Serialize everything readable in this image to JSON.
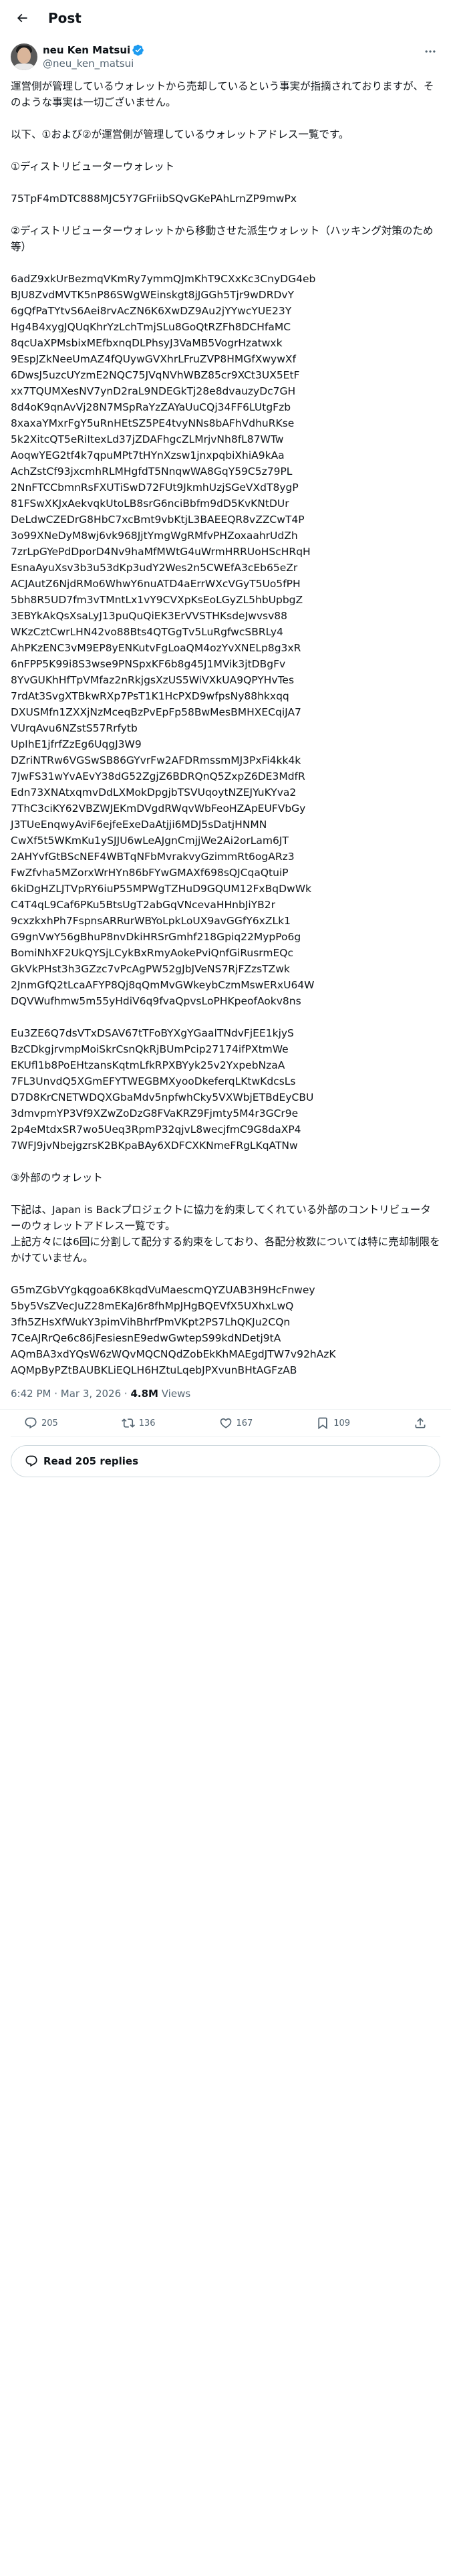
{
  "header": {
    "title": "Post"
  },
  "author": {
    "name": "neu Ken Matsui",
    "handle": "@neu_ken_matsui"
  },
  "post": {
    "body": "運営側が管理しているウォレットから売却しているという事実が指摘されておりますが、そのような事実は一切ございません。\n\n以下、①および②が運営側が管理しているウォレットアドレス一覧です。\n\n①ディストリビューターウォレット\n\n75TpF4mDTC888MJC5Y7GFriibSQvGKePAhLrnZP9mwPx\n\n②ディストリビューターウォレットから移動させた派生ウォレット（ハッキング対策のため等）\n\n6adZ9xkUrBezmqVKmRy7ymmQJmKhT9CXxKc3CnyDG4eb\nBJU8ZvdMVTK5nP86SWgWEinskgt8jJGGh5Tjr9wDRDvY\n6gQfPaTYtvS6Aei8rvAcZN6K6XwDZ9Au2jYYwcYUE23Y\nHg4B4xygJQUqKhrYzLchTmjSLu8GoQtRZFh8DCHfaMC\n8qcUaXPMsbixMEfbxnqDLPhsyJ3VaMB5VogrHzatwxk\n9EspJZkNeeUmAZ4fQUywGVXhrLFruZVP8HMGfXwywXf\n6DwsJ5uzcUYzmE2NQC75JVqNVhWBZ85cr9XCt3UX5EtF\nxx7TQUMXesNV7ynD2raL9NDEGkTj28e8dvauzyDc7GH\n8d4oK9qnAvVj28N7MSpRaYzZAYaUuCQj34FF6LUtgFzb\n8xaxaYMxrFgY5uRnHEtSZ5PE4tvyNNs8bAFhVdhuRKse\n5k2XitcQT5eRiItexLd37jZDAFhgcZLMrjvNh8fL87WTw\nAoqwYEG2tf4k7qpuMPt7tHYnXzsw1jnxpqbiXhiA9kAa\nAchZstCf93jxcmhRLMHgfdT5NnqwWA8GqY59C5z79PL\n2NnFTCCbmnRsFXUTiSwD72FUt9JkmhUzjSGeVXdT8ygP\n81FSwXKJxAekvqkUtoLB8srG6nciBbfm9dD5KvKNtDUr\nDeLdwCZEDrG8HbC7xcBmt9vbKtjL3BAEEQR8vZZCwT4P\n3o99XNeDyM8wj6vk968JjtYmgWgRMfvPHZoxaahrUdZh\n7zrLpGYePdDporD4Nv9haMfMWtG4uWrmHRRUoHScHRqH\nEsnaAyuXsv3b3u53dKp3udY2Wes2n5CWEfA3cEb65eZr\nACJAutZ6NjdRMo6WhwY6nuATD4aErrWXcVGyT5Uo5fPH\n5bh8R5UD7fm3vTMntLx1vY9CVXpKsEoLGyZL5hbUpbgZ\n3EBYkAkQsXsaLyJ13puQuQiEK3ErVVSTHKsdeJwvsv88\nWKzCztCwrLHN42vo88Bts4QTGgTv5LuRgfwcSBRLy4\nAhPKzENC3vM9EP8yENKutvFgLoaQM4ozYvXNELp8g3xR\n6nFPP5K99i8S3wse9PNSpxKF6b8g45J1MVik3jtDBgFv\n8YvGUKhHfTpVMfaz2nRkjgsXzUS5WiVXkUA9QPYHvTes\n7rdAt3SvgXTBkwRXp7PsT1K1HcPXD9wfpsNy88hkxqq\nDXUSMfn1ZXXjNzMceqBzPvEpFp58BwMesBMHXECqiJA7\nVUrqAvu6NZstS57Rrfytb\nUpIhE1jfrfZzEg6UqgJ3W9\nDZriNTRw6VGSwSB86GYvrFw2AFDRmssmMJ3PxFi4kk4k\n7JwFS31wYvAEvY38dG52ZgjZ6BDRQnQ5ZxpZ6DE3MdfR\nEdn73XNAtxqmvDdLXMokDpgjbTSVUqoytNZEJYuKYva2\n7ThC3ciKY62VBZWJEKmDVgdRWqvWbFeoHZApEUFVbGy\nJ3TUeEnqwyAviF6ejfeExeDaAtjji6MDJ5sDatjHNMN\nCwXf5t5WKmKu1ySJJU6wLeAJgnCmjjWe2Ai2orLam6JT\n2AHYvfGtBScNEF4WBTqNFbMvrakvyGzimmRt6ogARz3\nFwZfvha5MZorxWrHYn86bFYwGMAXf698sQJCqaQtuiP\n6kiDgHZLJTVpRY6iuP55MPWgTZHuD9GQUM12FxBqDwWk\nC4T4qL9Caf6PKu5BtsUgT2abGqVNcevaHHnbJiYB2r\n9cxzkxhPh7FspnsARRurWBYoLpkLoUX9avGGfY6xZLk1\nG9gnVwY56gBhuP8nvDkiHRSrGmhf218Gpiq22MypPo6g\nBomiNhXF2UkQYSjLCykBxRmyAokePviQnfGiRusrmEQc\nGkVkPHst3h3GZzc7vPcAgPW52gJbJVeNS7RjFZzsTZwk\n2JnmGfQ2tLcaAFYP8Qj8qQmMvGWkeybCzmMswERxU64W\nDQVWufhmw5m55yHdiV6q9fvaQpvsLoPHKpeofAokv8ns\n\nEu3ZE6Q7dsVTxDSAV67tTFoBYXgYGaalTNdvFjEE1kjyS\nBzCDkgjrvmpMoiSkrCsnQkRjBUmPcip27174ifPXtmWe\nEKUfl1b8PoEHtzansKqtmLfkRPXBYyk25v2YxpebNzaA\n7FL3UnvdQ5XGmEFYTWEGBMXyooDkeferqLKtwKdcsLs\nD7D8KrCNETWDQXGbaMdv5npfwhCky5VXWbjETBdEyCBU\n3dmvpmYP3Vf9XZwZoDzG8FVaKRZ9Fjmty5M4r3GCr9e\n2p4eMtdxSR7wo5Ueq3RpmP32qjvL8wecjfmC9G8daXP4\n7WFJ9jvNbejgzrsK2BKpaBAy6XDFCXKNmeFRgLKqATNw\n\n③外部のウォレット\n\n下記は、Japan is Backプロジェクトに協力を約束してくれている外部のコントリビューターのウォレットアドレス一覧です。\n上記方々には6回に分割して配分する約束をしており、各配分枚数については特に売却制限をかけていません。\n\nG5mZGbVYgkqgoa6K8kqdVuMaescmQYZUAB3H9HcFnwey\n5by5VsZVecJuZ28mEKaJ6r8fhMpJHgBQEVfX5UXhxLwQ\n3fh5ZHsXfWukY3pimVihBhrfPmVKpt2PS7LhQKJu2CQn\n7CeAJRrQe6c86jFesiesnE9edwGwtepS99kdNDetj9tA\nAQmBA3xdYQsW6zWQvMQCNQdZobEkKhMAEgdJTW7v92hAzK\nAQMpByPZtBAUBKLiEQLH6HZtuLqebJPXvunBHtAGFzAB"
  },
  "meta": {
    "time": "6:42 PM",
    "separator": "·",
    "date": "Mar 3, 2026",
    "views_count": "4.8M",
    "views_label": "Views"
  },
  "actions": {
    "reply_count": "205",
    "repost_count": "136",
    "like_count": "167",
    "bookmark_count": "109"
  },
  "replies_button": {
    "label": "Read 205 replies"
  },
  "colors": {
    "text": "#0f1419",
    "secondary": "#536471",
    "verified": "#1d9bf0",
    "border": "#eff3f4"
  }
}
